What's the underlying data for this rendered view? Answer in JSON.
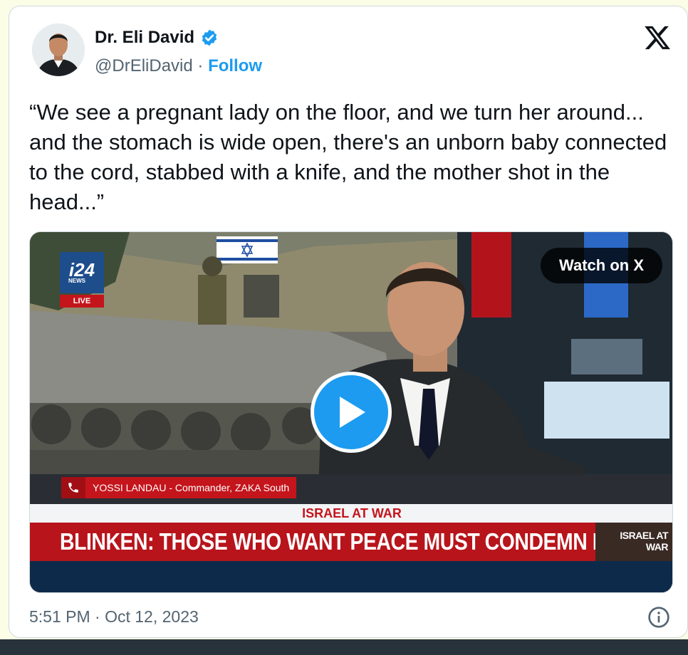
{
  "author": {
    "name": "Dr. Eli David",
    "handle": "@DrEliDavid",
    "separator": "·",
    "follow_label": "Follow",
    "verified_icon": "verified-badge-icon"
  },
  "brand": {
    "logo_icon": "x-logo-icon"
  },
  "tweet": {
    "text": "“We see a pregnant lady on the floor, and we turn her around... and the stomach is wide open, there's an unborn baby connected to the cord, stabbed with a knife, and the mother shot in the head...”",
    "timestamp": "5:51 PM · Oct 12, 2023"
  },
  "media": {
    "watch_label": "Watch on X",
    "play_icon": "play-icon",
    "channel_logo": "i24",
    "channel_logo_sub": "NEWS",
    "live_tag": "LIVE",
    "caption_name": "YOSSI LANDAU - Commander, ZAKA South",
    "ticker_top": "ISRAEL AT WAR",
    "ticker_main": "BLINKEN: THOSE WHO WANT PEACE MUST CONDEMN HAMAS",
    "ticker_badge": "ISRAEL AT WAR"
  },
  "colors": {
    "accent": "#1d9bf0",
    "text": "#0f1419",
    "muted": "#536471",
    "news_red": "#b8141b"
  }
}
